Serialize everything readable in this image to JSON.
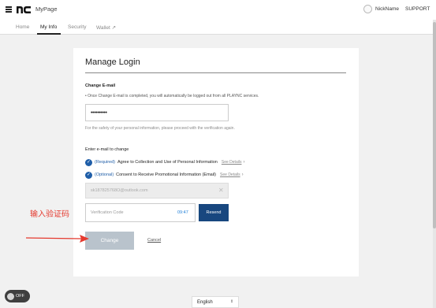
{
  "header": {
    "brand": "MyPage",
    "nickname": "NickName",
    "support": "SUPPORT"
  },
  "tabs": [
    {
      "label": "Home"
    },
    {
      "label": "My Info"
    },
    {
      "label": "Security"
    },
    {
      "label": "Wallet ↗"
    }
  ],
  "card": {
    "title": "Manage Login",
    "change_email_label": "Change E-mail",
    "notice": "• Once Change E-mail is completed, you will automatically be logged out from all PLAYNC services.",
    "password_value": "••••••••••",
    "safety_hint": "For the safety of your personal information, please proceed with the verification again.",
    "enter_email_label": "Enter e-mail to change",
    "agreements": [
      {
        "tag": "(Required)",
        "text": "Agree to Collection and Use of Personal Information",
        "link": "See Details"
      },
      {
        "tag": "(Optional)",
        "text": "Consent to Receive Promotional Information (Email)",
        "link": "See Details"
      }
    ],
    "email_value": "sk187825768O@outlook.com",
    "code_placeholder": "Verification Code",
    "timer": "09:47",
    "resend_label": "Resend",
    "change_label": "Change",
    "cancel_label": "Cancel"
  },
  "annotation": {
    "text": "输入验证码",
    "color": "#e53a2f"
  },
  "footer": {
    "toggle_label": "OFF",
    "language": "English"
  },
  "colors": {
    "accent": "#1f5ea8",
    "resend_bg": "#18477f",
    "disabled_btn": "#b9c3cc"
  }
}
